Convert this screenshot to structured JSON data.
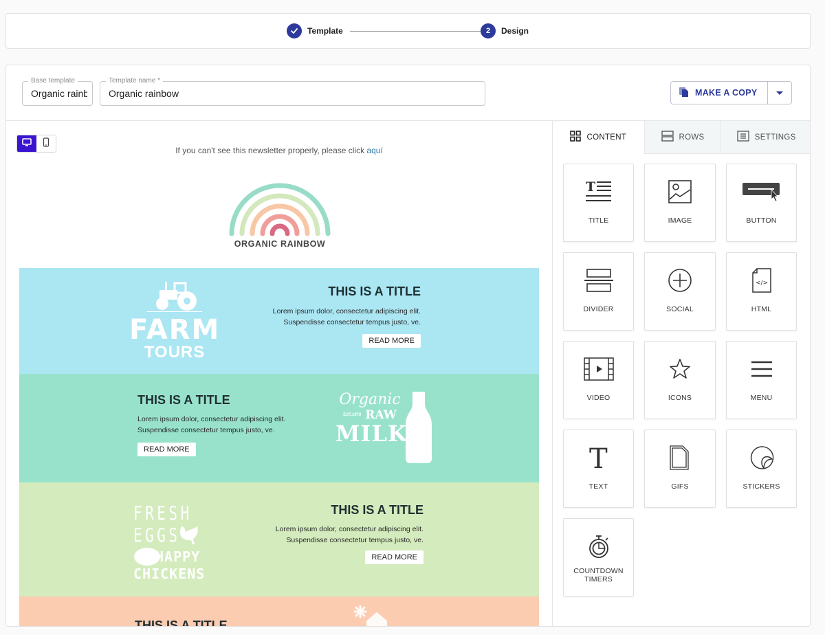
{
  "stepper": {
    "steps": [
      {
        "number": "1",
        "label": "Template",
        "status": "completed"
      },
      {
        "number": "2",
        "label": "Design",
        "status": "current"
      }
    ]
  },
  "topbar": {
    "base_template": {
      "label": "Base template",
      "value": "Organic rainbow"
    },
    "template_name": {
      "label": "Template name *",
      "value": "Organic rainbow"
    },
    "make_copy_label": "MAKE A COPY"
  },
  "canvas": {
    "device_toggle": {
      "active": "desktop",
      "options": [
        "desktop",
        "mobile"
      ]
    },
    "preheader_text": "If you can't see this newsletter properly, please click ",
    "preheader_link": "aquí",
    "logo_text": "ORGANIC RAINBOW",
    "logo_colors": [
      "#98dcc8",
      "#d3e8bd",
      "#f8c7a6",
      "#ef9e9a",
      "#d86a84"
    ],
    "rows": [
      {
        "title": "THIS IS A TITLE",
        "body_line1": "Lorem ipsum dolor, consectetur adipiscing elit.",
        "body_line2": "Suspendisse consectetur tempus justo, ve.",
        "button": "READ MORE",
        "art_line1": "FARM",
        "art_line2": "TOURS",
        "bg": "#abe6f3"
      },
      {
        "title": "THIS IS A TITLE",
        "body_line1": "Lorem ipsum dolor, consectetur adipiscing elit.",
        "body_line2": "Suspendisse consectetur tempus justo, ve.",
        "button": "READ MORE",
        "art_line1": "Organic",
        "art_line2": "RAW",
        "art_line3": "MILK",
        "art_small": "EST.1970",
        "bg": "#98e2cb"
      },
      {
        "title": "THIS IS A TITLE",
        "body_line1": "Lorem ipsum dolor, consectetur adipiscing elit.",
        "body_line2": "Suspendisse consectetur tempus justo, ve.",
        "button": "READ MORE",
        "art_line1": "FRESH",
        "art_line2": "EGGS",
        "art_line3": "HAPPY",
        "art_line4": "CHICKENS",
        "bg": "#d4ebbd"
      },
      {
        "title": "THIS IS A TITLE",
        "bg": "#fcccb1"
      }
    ]
  },
  "panel": {
    "tabs": [
      {
        "label": "CONTENT",
        "icon": "grid-icon",
        "active": true
      },
      {
        "label": "ROWS",
        "icon": "rows-icon",
        "active": false
      },
      {
        "label": "SETTINGS",
        "icon": "settings-doc-icon",
        "active": false
      }
    ],
    "tiles": [
      {
        "label": "TITLE",
        "icon": "title-icon"
      },
      {
        "label": "IMAGE",
        "icon": "image-icon"
      },
      {
        "label": "BUTTON",
        "icon": "button-icon"
      },
      {
        "label": "DIVIDER",
        "icon": "divider-icon"
      },
      {
        "label": "SOCIAL",
        "icon": "social-icon"
      },
      {
        "label": "HTML",
        "icon": "html-icon"
      },
      {
        "label": "VIDEO",
        "icon": "video-icon"
      },
      {
        "label": "ICONS",
        "icon": "star-icon"
      },
      {
        "label": "MENU",
        "icon": "menu-icon"
      },
      {
        "label": "TEXT",
        "icon": "text-icon"
      },
      {
        "label": "GIFS",
        "icon": "gifs-icon"
      },
      {
        "label": "STICKERS",
        "icon": "sticker-icon"
      },
      {
        "label": "COUNTDOWN TIMERS",
        "icon": "timer-icon"
      }
    ]
  },
  "colors": {
    "accent": "#2d3a9c",
    "device_active": "#3b14d1",
    "link": "#2f7aa6"
  }
}
